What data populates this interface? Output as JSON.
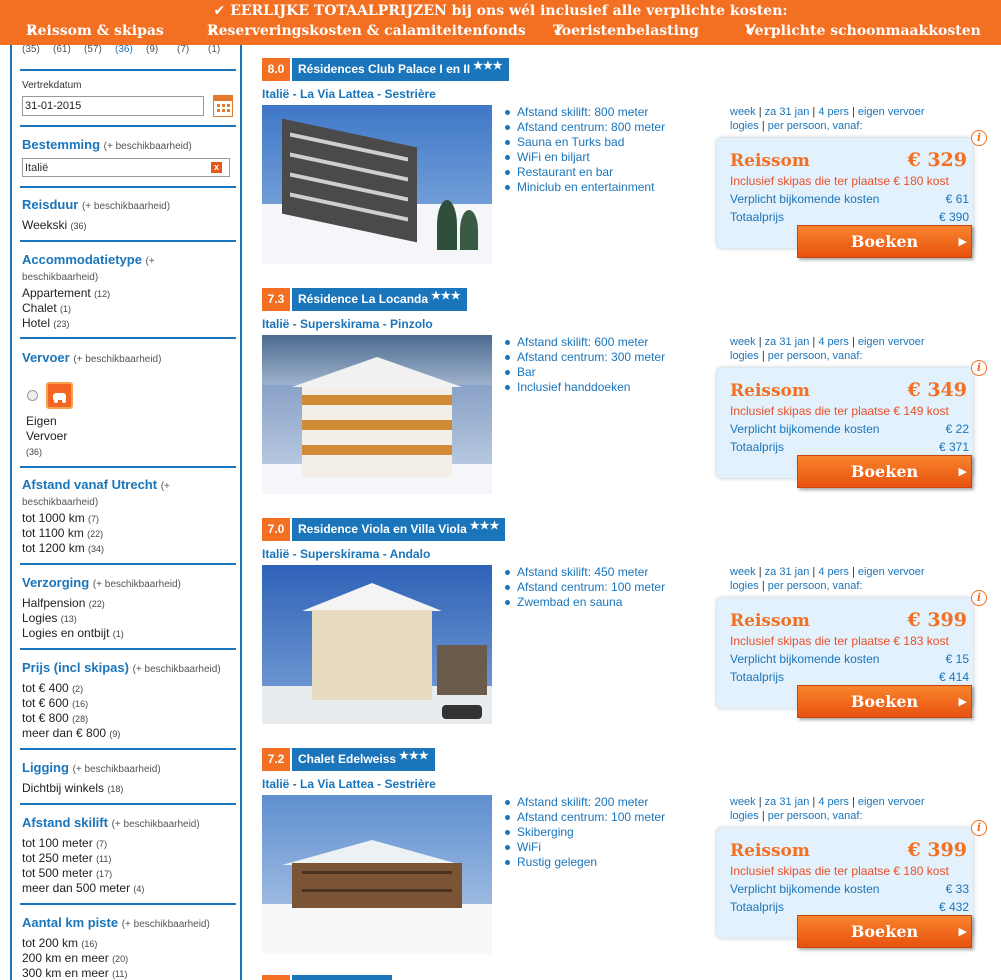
{
  "banner": {
    "title": "EERLIJKE TOTAALPRIJZEN bij ons wél inclusief alle verplichte kosten:",
    "items": [
      "Reissom & skipas",
      "Reserveringskosten & calamiteitenfonds",
      "Toeristenbelasting",
      "Verplichte schoonmaakkosten"
    ]
  },
  "sidebar": {
    "top_counts": [
      "(35)",
      "(61)",
      "(57)",
      "(36)",
      "(9)",
      "(7)",
      "(1)"
    ],
    "date_label": "Vertrekdatum",
    "date_value": "31-01-2015",
    "hint": "(+ beschikbaarheid)",
    "destination": {
      "title": "Bestemming",
      "value": "Italië"
    },
    "duration": {
      "title": "Reisduur",
      "items": [
        {
          "label": "Weekski",
          "count": "(36)"
        }
      ]
    },
    "accommodation": {
      "title": "Accommodatietype",
      "items": [
        {
          "label": "Appartement",
          "count": "(12)"
        },
        {
          "label": "Chalet",
          "count": "(1)"
        },
        {
          "label": "Hotel",
          "count": "(23)"
        }
      ]
    },
    "transport": {
      "title": "Vervoer",
      "option_line1": "Eigen",
      "option_line2": "Vervoer",
      "count": "(36)"
    },
    "distance_utrecht": {
      "title": "Afstand vanaf Utrecht",
      "items": [
        {
          "label": "tot 1000 km",
          "count": "(7)"
        },
        {
          "label": "tot 1100 km",
          "count": "(22)"
        },
        {
          "label": "tot 1200 km",
          "count": "(34)"
        }
      ]
    },
    "board": {
      "title": "Verzorging",
      "items": [
        {
          "label": "Halfpension",
          "count": "(22)"
        },
        {
          "label": "Logies",
          "count": "(13)"
        },
        {
          "label": "Logies en ontbijt",
          "count": "(1)"
        }
      ]
    },
    "price": {
      "title": "Prijs (incl skipas)",
      "items": [
        {
          "label": "tot € 400",
          "count": "(2)"
        },
        {
          "label": "tot € 600",
          "count": "(16)"
        },
        {
          "label": "tot € 800",
          "count": "(28)"
        },
        {
          "label": "meer dan € 800",
          "count": "(9)"
        }
      ]
    },
    "location": {
      "title": "Ligging",
      "items": [
        {
          "label": "Dichtbij winkels",
          "count": "(18)"
        }
      ]
    },
    "skilift": {
      "title": "Afstand skilift",
      "items": [
        {
          "label": "tot 100 meter",
          "count": "(7)"
        },
        {
          "label": "tot 250 meter",
          "count": "(11)"
        },
        {
          "label": "tot 500 meter",
          "count": "(17)"
        },
        {
          "label": "meer dan 500 meter",
          "count": "(4)"
        }
      ]
    },
    "piste": {
      "title": "Aantal km piste",
      "items": [
        {
          "label": "tot 200 km",
          "count": "(16)"
        },
        {
          "label": "200 km en meer",
          "count": "(20)"
        },
        {
          "label": "300 km en meer",
          "count": "(11)"
        }
      ]
    }
  },
  "common": {
    "meta_line1": [
      "week",
      "za 31 jan",
      "4 pers",
      "eigen vervoer"
    ],
    "meta_line2": [
      "logies",
      "per persoon, vanaf:"
    ],
    "brand": "Reissom",
    "extra_label": "Verplicht bijkomende kosten",
    "total_label": "Totaalprijs",
    "book_label": "Boeken",
    "info": "i",
    "stars": "★★★"
  },
  "listings": [
    {
      "rating": "8.0",
      "name": "Résidences Club Palace I en II",
      "location": "Italië - La Via Lattea - Sestrière",
      "features": [
        "Afstand skilift: 800 meter",
        "Afstand centrum: 800 meter",
        "Sauna en Turks bad",
        "WiFi en biljart",
        "Restaurant en bar",
        "Miniclub en entertainment"
      ],
      "price": "€ 329",
      "skipas": "Inclusief skipas die ter plaatse € 180 kost",
      "extra": "€ 61",
      "total": "€ 390"
    },
    {
      "rating": "7.3",
      "name": "Résidence La Locanda",
      "location": "Italië - Superskirama - Pinzolo",
      "features": [
        "Afstand skilift: 600 meter",
        "Afstand centrum: 300 meter",
        "Bar",
        "Inclusief handdoeken"
      ],
      "price": "€ 349",
      "skipas": "Inclusief skipas die ter plaatse € 149 kost",
      "extra": "€ 22",
      "total": "€ 371"
    },
    {
      "rating": "7.0",
      "name": "Residence Viola en Villa Viola",
      "location": "Italië - Superskirama - Andalo",
      "features": [
        "Afstand skilift: 450 meter",
        "Afstand centrum: 100 meter",
        "Zwembad en sauna"
      ],
      "price": "€ 399",
      "skipas": "Inclusief skipas die ter plaatse € 183 kost",
      "extra": "€ 15",
      "total": "€ 414"
    },
    {
      "rating": "7.2",
      "name": "Chalet Edelweiss",
      "location": "Italië - La Via Lattea - Sestrière",
      "features": [
        "Afstand skilift: 200 meter",
        "Afstand centrum: 100 meter",
        "Skiberging",
        "WiFi",
        "Rustig gelegen"
      ],
      "price": "€ 399",
      "skipas": "Inclusief skipas die ter plaatse € 180 kost",
      "extra": "€ 33",
      "total": "€ 432"
    }
  ],
  "colors": {
    "orange": "#f36f21",
    "blue": "#1a75bb",
    "price_bg": "#e2f1fb"
  }
}
